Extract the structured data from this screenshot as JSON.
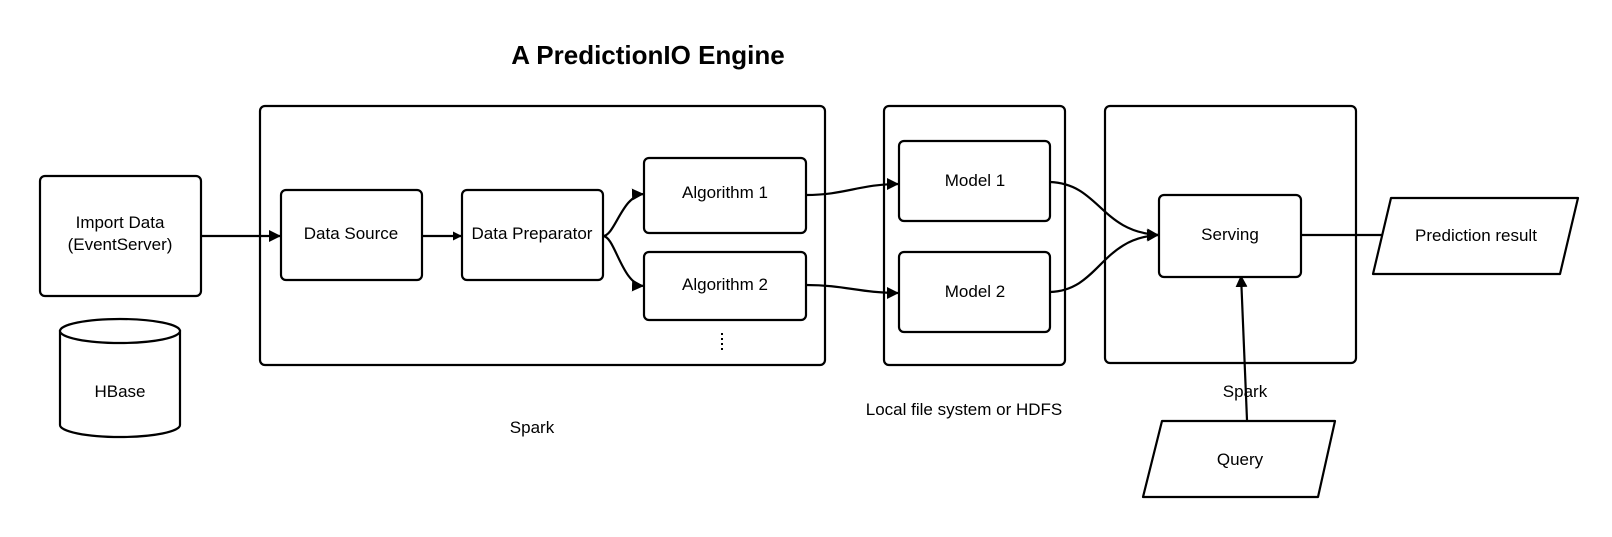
{
  "title": "A PredictionIO Engine",
  "nodes": {
    "import_data": [
      "Import Data",
      "(EventServer)"
    ],
    "hbase": "HBase",
    "data_source": "Data Source",
    "data_preparator": "Data Preparator",
    "algorithm_1": "Algorithm 1",
    "algorithm_2": "Algorithm 2",
    "more": "⋮",
    "model_1": "Model 1",
    "model_2": "Model 2",
    "serving": "Serving",
    "prediction_result": "Prediction result",
    "query": "Query"
  },
  "group_labels": {
    "training": "Spark",
    "storage": "Local file system or HDFS",
    "serving": "Spark"
  },
  "edges": [
    {
      "from": "Import Data",
      "to": "Data Source"
    },
    {
      "from": "Data Source",
      "to": "Data Preparator"
    },
    {
      "from": "Data Preparator",
      "to": "Algorithm 1"
    },
    {
      "from": "Data Preparator",
      "to": "Algorithm 2"
    },
    {
      "from": "Algorithm 1",
      "to": "Model 1"
    },
    {
      "from": "Algorithm 2",
      "to": "Model 2"
    },
    {
      "from": "Model 1",
      "to": "Serving"
    },
    {
      "from": "Model 2",
      "to": "Serving"
    },
    {
      "from": "Serving",
      "to": "Prediction result"
    },
    {
      "from": "Query",
      "to": "Serving"
    }
  ]
}
